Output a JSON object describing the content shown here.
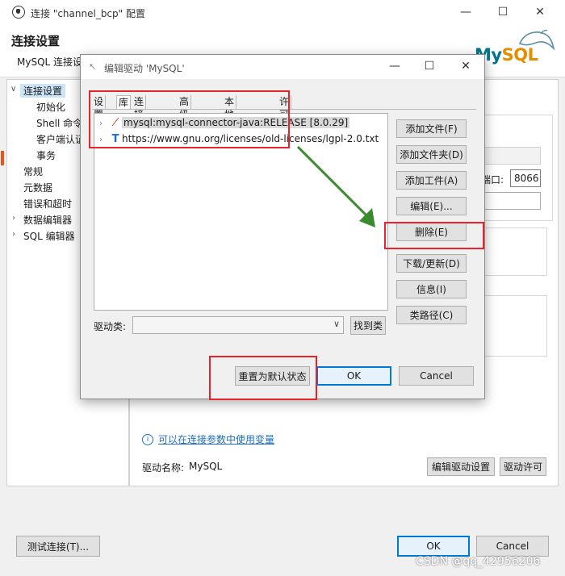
{
  "main_window": {
    "title": "连接 \"channel_bcp\" 配置",
    "header_title": "连接设置",
    "header_subtitle": "MySQL 连接设",
    "logo_text_my": "My",
    "logo_text_sql": "SQL"
  },
  "tree": {
    "items": [
      {
        "label": "连接设置"
      },
      {
        "label": "初始化"
      },
      {
        "label": "Shell 命令"
      },
      {
        "label": "客户端认证"
      },
      {
        "label": "事务"
      },
      {
        "label": "常规"
      },
      {
        "label": "元数据"
      },
      {
        "label": "错误和超时"
      },
      {
        "label": "数据编辑器"
      },
      {
        "label": "SQL 编辑器"
      }
    ]
  },
  "right_panel": {
    "port_label": "端口:",
    "port_value": "8066",
    "variables_link": "可以在连接参数中使用变量",
    "driver_name_label": "驱动名称:",
    "driver_name_value": "MySQL",
    "edit_driver_button": "编辑驱动设置",
    "driver_license_button": "驱动许可"
  },
  "footer": {
    "test_connection_button": "测试连接(T)...",
    "ok_button": "OK",
    "cancel_button": "Cancel"
  },
  "dialog": {
    "title": "编辑驱动 'MySQL'",
    "tabs": [
      {
        "label": "设置"
      },
      {
        "label": "库"
      },
      {
        "label": "连接属性"
      },
      {
        "label": "高级参数"
      },
      {
        "label": "本地客户端"
      },
      {
        "label": "许可"
      }
    ],
    "libraries": [
      {
        "label": "mysql:mysql-connector-java:RELEASE [8.0.29]",
        "icon": "maven-feather-icon"
      },
      {
        "label": "https://www.gnu.org/licenses/old-licenses/lgpl-2.0.txt",
        "icon": "text-file-icon"
      }
    ],
    "side_buttons": {
      "add_file": "添加文件(F)",
      "add_folder": "添加文件夹(D)",
      "add_artifact": "添加工件(A)",
      "edit": "编辑(E)...",
      "delete": "删除(E)",
      "download_update": "下载/更新(D)",
      "info": "信息(I)",
      "classpath": "类路径(C)"
    },
    "driver_class_label": "驱动类:",
    "driver_class_value": "",
    "find_class_button": "找到类",
    "reset_default_button": "重置为默认状态",
    "ok_button": "OK",
    "cancel_button": "Cancel"
  },
  "watermark": "CSDN @qq_42956206",
  "colors": {
    "highlight_red": "#e8242a",
    "arrow_green": "#3a8a2e",
    "accent_blue": "#0078d7",
    "link_blue": "#1e6fbf"
  }
}
